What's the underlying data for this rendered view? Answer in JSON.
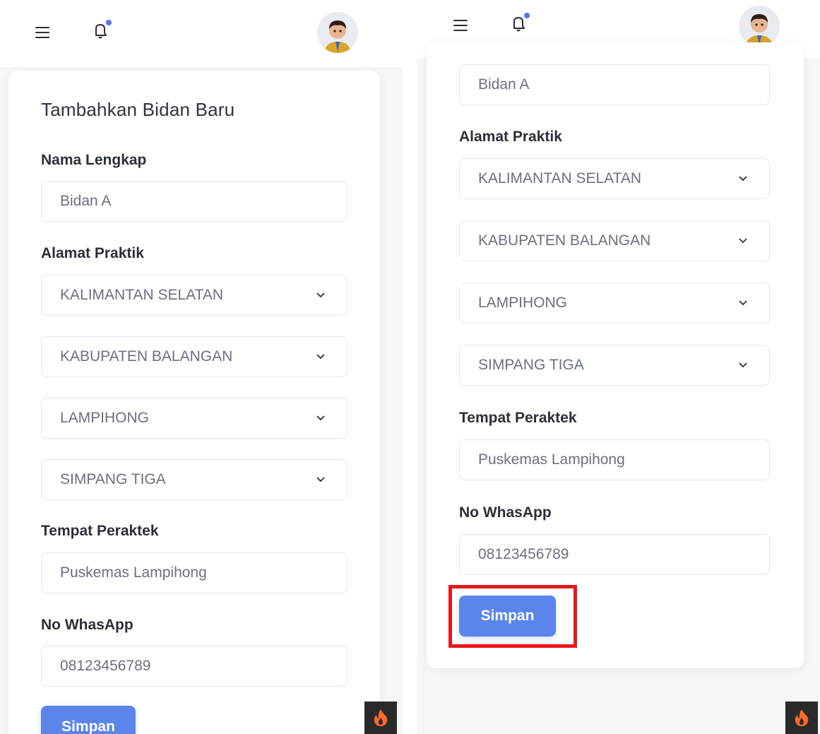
{
  "left": {
    "form_title": "Tambahkan Bidan Baru",
    "nama_label": "Nama Lengkap",
    "nama_value": "Bidan A",
    "alamat_label": "Alamat Praktik",
    "province": "KALIMANTAN SELATAN",
    "regency": "KABUPATEN BALANGAN",
    "district": "LAMPIHONG",
    "village": "SIMPANG TIGA",
    "tempat_label": "Tempat Peraktek",
    "tempat_value": "Puskemas Lampihong",
    "wa_label": "No WhasApp",
    "wa_value": "08123456789",
    "save_label": "Simpan"
  },
  "right": {
    "nama_value": "Bidan A",
    "alamat_label": "Alamat Praktik",
    "province": "KALIMANTAN SELATAN",
    "regency": "KABUPATEN BALANGAN",
    "district": "LAMPIHONG",
    "village": "SIMPANG TIGA",
    "tempat_label": "Tempat Peraktek",
    "tempat_value": "Puskemas Lampihong",
    "wa_label": "No WhasApp",
    "wa_value": "08123456789",
    "save_label": "Simpan"
  },
  "icons": {
    "menu": "hamburger-menu-icon",
    "notification": "bell-icon",
    "chevron": "chevron-down-icon",
    "flame": "flame-icon"
  },
  "colors": {
    "accent": "#5b85ea",
    "notification_dot": "#4f78f0",
    "highlight": "#e8161b",
    "flame": "#ff6a2b"
  }
}
